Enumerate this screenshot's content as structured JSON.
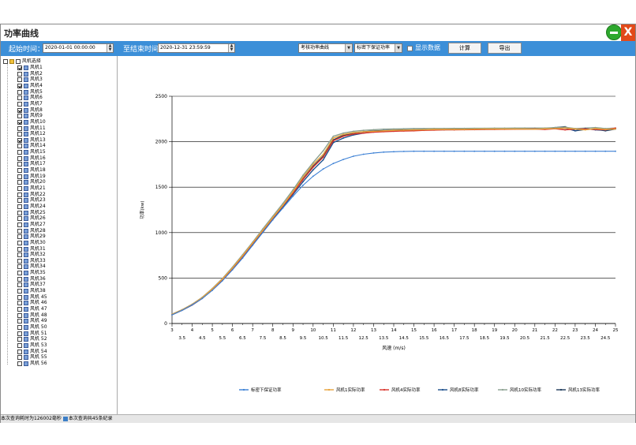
{
  "window": {
    "title": "功率曲线"
  },
  "toolbar": {
    "start_label": "起始时间：",
    "start_value": "2020-01-01 00:00:00",
    "end_label": "至结束时间",
    "end_value": "2020-12-31 23:59:59",
    "curve_select": "考核功率曲线",
    "density_select": "标密下保证功率",
    "show_data_label": "显示数据",
    "calc_label": "计算",
    "export_label": "导出"
  },
  "tree": {
    "root_label": "风机选择",
    "items": [
      {
        "label": "风机1",
        "checked": true
      },
      {
        "label": "风机2",
        "checked": false
      },
      {
        "label": "风机3",
        "checked": false
      },
      {
        "label": "风机4",
        "checked": true
      },
      {
        "label": "风机5",
        "checked": false
      },
      {
        "label": "风机6",
        "checked": false
      },
      {
        "label": "风机7",
        "checked": false
      },
      {
        "label": "风机8",
        "checked": true
      },
      {
        "label": "风机9",
        "checked": false
      },
      {
        "label": "风机10",
        "checked": true
      },
      {
        "label": "风机11",
        "checked": false
      },
      {
        "label": "风机12",
        "checked": false
      },
      {
        "label": "风机13",
        "checked": true
      },
      {
        "label": "风机14",
        "checked": false
      },
      {
        "label": "风机15",
        "checked": false
      },
      {
        "label": "风机16",
        "checked": false
      },
      {
        "label": "风机17",
        "checked": false
      },
      {
        "label": "风机18",
        "checked": false
      },
      {
        "label": "风机19",
        "checked": false
      },
      {
        "label": "风机20",
        "checked": false
      },
      {
        "label": "风机21",
        "checked": false
      },
      {
        "label": "风机22",
        "checked": false
      },
      {
        "label": "风机23",
        "checked": false
      },
      {
        "label": "风机24",
        "checked": false
      },
      {
        "label": "风机25",
        "checked": false
      },
      {
        "label": "风机26",
        "checked": false
      },
      {
        "label": "风机27",
        "checked": false
      },
      {
        "label": "风机28",
        "checked": false
      },
      {
        "label": "风机29",
        "checked": false
      },
      {
        "label": "风机30",
        "checked": false
      },
      {
        "label": "风机31",
        "checked": false
      },
      {
        "label": "风机32",
        "checked": false
      },
      {
        "label": "风机33",
        "checked": false
      },
      {
        "label": "风机34",
        "checked": false
      },
      {
        "label": "风机35",
        "checked": false
      },
      {
        "label": "风机36",
        "checked": false
      },
      {
        "label": "风机37",
        "checked": false
      },
      {
        "label": "风机38",
        "checked": false
      },
      {
        "label": "风机 45",
        "checked": false
      },
      {
        "label": "风机 46",
        "checked": false
      },
      {
        "label": "风机 47",
        "checked": false
      },
      {
        "label": "风机 48",
        "checked": false
      },
      {
        "label": "风机 49",
        "checked": false
      },
      {
        "label": "风机 50",
        "checked": false
      },
      {
        "label": "风机 51",
        "checked": false
      },
      {
        "label": "风机 52",
        "checked": false
      },
      {
        "label": "风机 53",
        "checked": false
      },
      {
        "label": "风机 54",
        "checked": false
      },
      {
        "label": "风机 55",
        "checked": false
      },
      {
        "label": "风机 56",
        "checked": false
      }
    ]
  },
  "status": {
    "time_text": "本次查询耗时为126002毫秒",
    "count_text": "本次查询共45条纪录"
  },
  "chart_data": {
    "type": "line",
    "xlabel": "风速 (m/s)",
    "ylabel": "功率(kw)",
    "xlim": [
      3,
      25
    ],
    "ylim": [
      0,
      2500
    ],
    "yticks": [
      0,
      500,
      1000,
      1500,
      2000,
      2500
    ],
    "xticks_major": [
      "3",
      "4",
      "5",
      "6",
      "7",
      "8",
      "9",
      "10",
      "11",
      "12",
      "13",
      "14",
      "15",
      "16",
      "17",
      "18",
      "19",
      "20",
      "21",
      "22",
      "23",
      "24",
      "25"
    ],
    "xticks_minor": [
      "3.5",
      "4.5",
      "5.5",
      "6.5",
      "7.5",
      "8.5",
      "9.5",
      "10.5",
      "11.5",
      "12.5",
      "13.5",
      "14.5",
      "15.5",
      "16.5",
      "17.5",
      "18.5",
      "19.5",
      "20.5",
      "21.5",
      "22.5",
      "23.5",
      "24.5"
    ],
    "grid": "horizontal",
    "legend_position": "bottom",
    "colors": [
      "#3a7fd4",
      "#e8a23a",
      "#d8322a",
      "#1c4f8c",
      "#8aa090",
      "#1e3a5a"
    ],
    "x": [
      3,
      3.5,
      4,
      4.5,
      5,
      5.5,
      6,
      6.5,
      7,
      7.5,
      8,
      8.5,
      9,
      9.5,
      10,
      10.5,
      11,
      11.5,
      12,
      12.5,
      13,
      13.5,
      14,
      14.5,
      15,
      15.5,
      16,
      16.5,
      17,
      17.5,
      18,
      18.5,
      19,
      19.5,
      20,
      20.5,
      21,
      21.5,
      22,
      22.5,
      23,
      23.5,
      24,
      24.5,
      25
    ],
    "series": [
      {
        "name": "标密下保证功率",
        "values": [
          95,
          145,
          205,
          275,
          365,
          470,
          590,
          720,
          860,
          1000,
          1140,
          1270,
          1400,
          1520,
          1620,
          1700,
          1760,
          1805,
          1840,
          1862,
          1876,
          1885,
          1890,
          1893,
          1895,
          1895,
          1895,
          1895,
          1895,
          1895,
          1895,
          1895,
          1895,
          1895,
          1895,
          1895,
          1895,
          1895,
          1895,
          1895,
          1895,
          1895,
          1895,
          1895,
          1895
        ]
      },
      {
        "name": "风机1实际功率",
        "values": [
          100,
          150,
          210,
          285,
          380,
          490,
          610,
          745,
          885,
          1025,
          1165,
          1300,
          1450,
          1610,
          1750,
          1860,
          2040,
          2080,
          2100,
          2110,
          2115,
          2120,
          2125,
          2128,
          2130,
          2132,
          2135,
          2135,
          2135,
          2135,
          2138,
          2140,
          2140,
          2140,
          2140,
          2140,
          2138,
          2142,
          2145,
          2150,
          2140,
          2130,
          2145,
          2135,
          2140
        ]
      },
      {
        "name": "风机4实际功率",
        "values": [
          98,
          148,
          205,
          278,
          372,
          482,
          602,
          738,
          880,
          1020,
          1160,
          1295,
          1435,
          1585,
          1720,
          1830,
          2010,
          2060,
          2085,
          2095,
          2105,
          2110,
          2115,
          2118,
          2120,
          2125,
          2128,
          2130,
          2130,
          2132,
          2133,
          2135,
          2135,
          2136,
          2137,
          2138,
          2140,
          2135,
          2142,
          2130,
          2138,
          2140,
          2135,
          2130,
          2150
        ]
      },
      {
        "name": "风机8实际功率",
        "values": [
          96,
          146,
          203,
          276,
          370,
          480,
          600,
          735,
          875,
          1015,
          1150,
          1285,
          1420,
          1560,
          1690,
          1800,
          1990,
          2040,
          2075,
          2095,
          2108,
          2115,
          2120,
          2124,
          2126,
          2128,
          2130,
          2132,
          2133,
          2134,
          2135,
          2136,
          2137,
          2138,
          2139,
          2140,
          2141,
          2140,
          2145,
          2150,
          2120,
          2145,
          2130,
          2125,
          2145
        ]
      },
      {
        "name": "风机10实际功率",
        "values": [
          102,
          152,
          212,
          288,
          385,
          495,
          620,
          755,
          895,
          1040,
          1180,
          1320,
          1470,
          1630,
          1770,
          1900,
          2060,
          2095,
          2115,
          2125,
          2132,
          2138,
          2140,
          2142,
          2144,
          2145,
          2146,
          2146,
          2147,
          2147,
          2148,
          2148,
          2149,
          2149,
          2150,
          2150,
          2150,
          2150,
          2155,
          2160,
          2145,
          2150,
          2155,
          2145,
          2150
        ]
      },
      {
        "name": "风机13实际功率",
        "values": [
          97,
          147,
          207,
          280,
          374,
          485,
          605,
          740,
          882,
          1022,
          1162,
          1298,
          1440,
          1590,
          1730,
          1840,
          2020,
          2070,
          2095,
          2110,
          2118,
          2122,
          2128,
          2130,
          2132,
          2134,
          2136,
          2137,
          2138,
          2138,
          2139,
          2140,
          2140,
          2140,
          2141,
          2141,
          2140,
          2142,
          2155,
          2165,
          2120,
          2135,
          2140,
          2120,
          2140
        ]
      }
    ]
  }
}
